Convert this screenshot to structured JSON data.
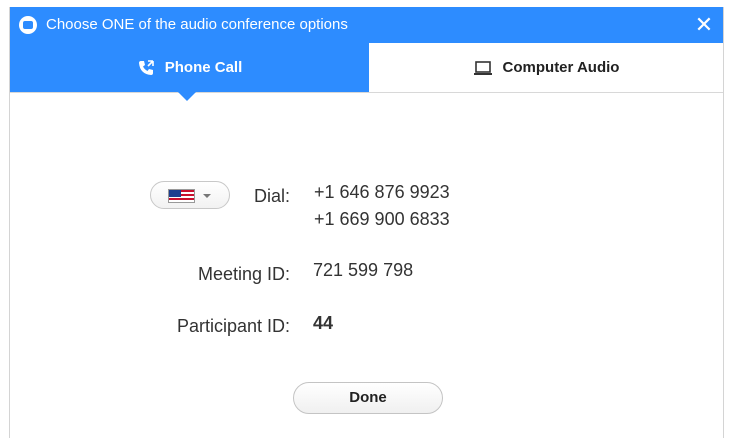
{
  "window": {
    "title": "Choose ONE of the audio conference options",
    "close_glyph": "✕",
    "accent_color": "#2d8cff"
  },
  "tabs": [
    {
      "label": "Phone Call",
      "icon": "phone-call-icon",
      "selected": true
    },
    {
      "label": "Computer Audio",
      "icon": "laptop-icon",
      "selected": false
    }
  ],
  "phone": {
    "country_flag": "us-flag-icon",
    "dial_label": "Dial:",
    "dial_numbers": [
      "+1 646 876 9923",
      "+1 669 900 6833"
    ],
    "meeting_id_label": "Meeting ID:",
    "meeting_id": "721 599 798",
    "participant_id_label": "Participant ID:",
    "participant_id": "44"
  },
  "done_label": "Done"
}
